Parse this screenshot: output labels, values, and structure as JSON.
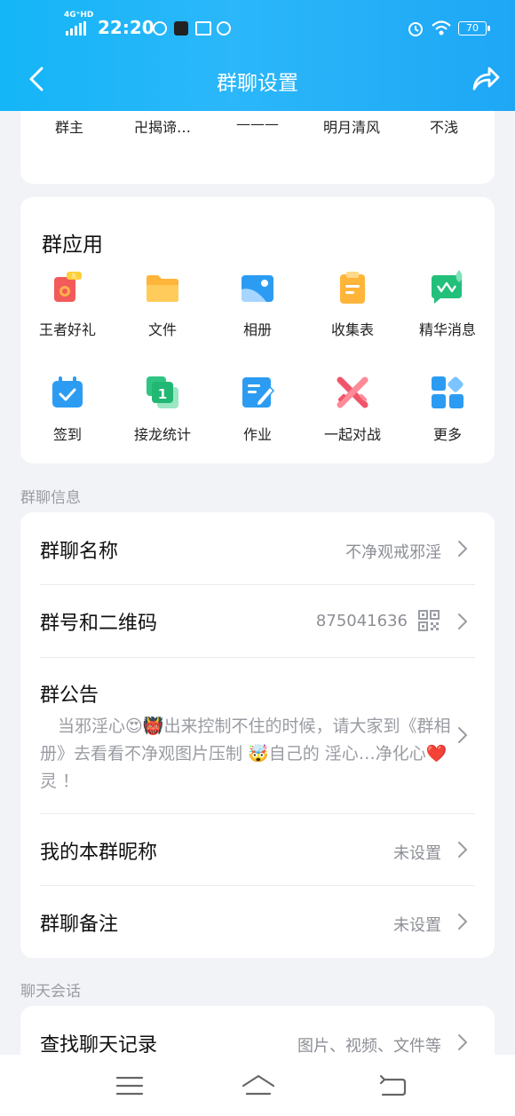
{
  "status_bar": {
    "network": "4G⁺HD",
    "time": "22:20",
    "battery": "70"
  },
  "header": {
    "title": "群聊设置"
  },
  "members": [
    {
      "name": "群主",
      "color": "#9a9a9a"
    },
    {
      "name": "卍揭谛…",
      "color": "#2c4a7a"
    },
    {
      "name": "———",
      "color": "#c9a48a"
    },
    {
      "name": "明月清风",
      "color": "#2a2a2a"
    },
    {
      "name": "不浅",
      "color": "#555555"
    }
  ],
  "group_apps": {
    "title": "群应用",
    "items": [
      {
        "label": "王者好礼",
        "icon": "gift-icon"
      },
      {
        "label": "文件",
        "icon": "folder-icon"
      },
      {
        "label": "相册",
        "icon": "album-icon"
      },
      {
        "label": "收集表",
        "icon": "clipboard-icon"
      },
      {
        "label": "精华消息",
        "icon": "essence-message-icon"
      },
      {
        "label": "签到",
        "icon": "calendar-check-icon"
      },
      {
        "label": "接龙统计",
        "icon": "relay-icon"
      },
      {
        "label": "作业",
        "icon": "homework-icon"
      },
      {
        "label": "一起对战",
        "icon": "battle-icon"
      },
      {
        "label": "更多",
        "icon": "more-grid-icon"
      }
    ]
  },
  "info_section": {
    "label": "群聊信息",
    "group_name": {
      "key": "群聊名称",
      "value": "不净观戒邪淫"
    },
    "group_number": {
      "key": "群号和二维码",
      "value": "875041636"
    },
    "announcement": {
      "key": "群公告",
      "text": "当邪淫心😍👹出来控制不住的时候，请大家到《群相册》去看看不净观图片压制 🤯自己的 淫心…净化心❤️灵 ！"
    },
    "my_nickname": {
      "key": "我的本群昵称",
      "value": "未设置"
    },
    "remark": {
      "key": "群聊备注",
      "value": "未设置"
    }
  },
  "chat_section": {
    "label": "聊天会话",
    "search_history": {
      "key": "查找聊天记录",
      "value": "图片、视频、文件等"
    }
  },
  "colors": {
    "accent": "#1ea7f5",
    "background": "#f2f3f7"
  }
}
